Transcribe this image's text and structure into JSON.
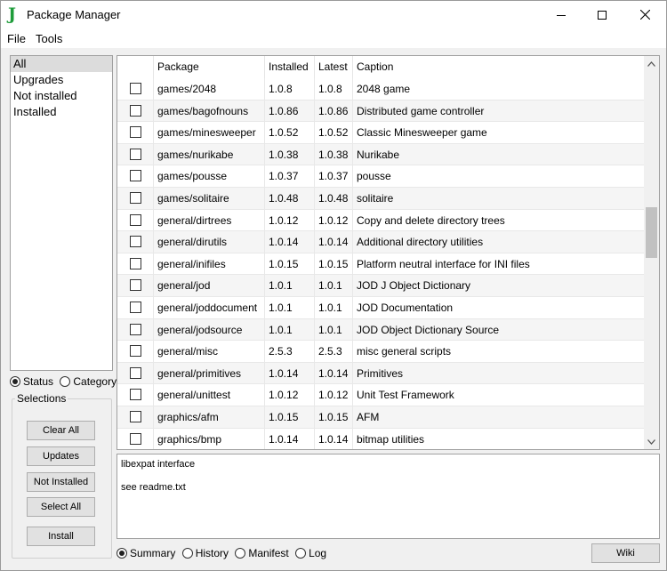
{
  "window": {
    "title": "Package Manager",
    "app_icon_glyph": "J"
  },
  "menu": {
    "file": "File",
    "tools": "Tools"
  },
  "filters": {
    "items": [
      {
        "label": "All",
        "selected": true
      },
      {
        "label": "Upgrades",
        "selected": false
      },
      {
        "label": "Not installed",
        "selected": false
      },
      {
        "label": "Installed",
        "selected": false
      }
    ]
  },
  "view_mode": {
    "status": "Status",
    "category": "Category",
    "selected": "Status"
  },
  "selections": {
    "title": "Selections",
    "clear_all": "Clear All",
    "updates": "Updates",
    "not_installed": "Not Installed",
    "select_all": "Select All",
    "install": "Install"
  },
  "table": {
    "headers": {
      "package": "Package",
      "installed": "Installed",
      "latest": "Latest",
      "caption": "Caption"
    },
    "rows": [
      {
        "package": "games/2048",
        "installed": "1.0.8",
        "latest": "1.0.8",
        "caption": "2048 game"
      },
      {
        "package": "games/bagofnouns",
        "installed": "1.0.86",
        "latest": "1.0.86",
        "caption": "Distributed game controller"
      },
      {
        "package": "games/minesweeper",
        "installed": "1.0.52",
        "latest": "1.0.52",
        "caption": "Classic Minesweeper game"
      },
      {
        "package": "games/nurikabe",
        "installed": "1.0.38",
        "latest": "1.0.38",
        "caption": "Nurikabe"
      },
      {
        "package": "games/pousse",
        "installed": "1.0.37",
        "latest": "1.0.37",
        "caption": "pousse"
      },
      {
        "package": "games/solitaire",
        "installed": "1.0.48",
        "latest": "1.0.48",
        "caption": "solitaire"
      },
      {
        "package": "general/dirtrees",
        "installed": "1.0.12",
        "latest": "1.0.12",
        "caption": "Copy and delete directory trees"
      },
      {
        "package": "general/dirutils",
        "installed": "1.0.14",
        "latest": "1.0.14",
        "caption": "Additional directory utilities"
      },
      {
        "package": "general/inifiles",
        "installed": "1.0.15",
        "latest": "1.0.15",
        "caption": "Platform neutral interface for INI files"
      },
      {
        "package": "general/jod",
        "installed": "1.0.1",
        "latest": "1.0.1",
        "caption": "JOD J Object Dictionary"
      },
      {
        "package": "general/joddocument",
        "installed": "1.0.1",
        "latest": "1.0.1",
        "caption": "JOD Documentation"
      },
      {
        "package": "general/jodsource",
        "installed": "1.0.1",
        "latest": "1.0.1",
        "caption": "JOD Object Dictionary Source"
      },
      {
        "package": "general/misc",
        "installed": "2.5.3",
        "latest": "2.5.3",
        "caption": "misc general scripts"
      },
      {
        "package": "general/primitives",
        "installed": "1.0.14",
        "latest": "1.0.14",
        "caption": "Primitives"
      },
      {
        "package": "general/unittest",
        "installed": "1.0.12",
        "latest": "1.0.12",
        "caption": "Unit Test Framework"
      },
      {
        "package": "graphics/afm",
        "installed": "1.0.15",
        "latest": "1.0.15",
        "caption": "AFM"
      },
      {
        "package": "graphics/bmp",
        "installed": "1.0.14",
        "latest": "1.0.14",
        "caption": "bitmap utilities"
      }
    ]
  },
  "description": {
    "line1": "libexpat interface",
    "line2": "see readme.txt"
  },
  "detail_tabs": {
    "summary": "Summary",
    "history": "History",
    "manifest": "Manifest",
    "log": "Log",
    "selected": "Summary"
  },
  "wiki_button": "Wiki"
}
